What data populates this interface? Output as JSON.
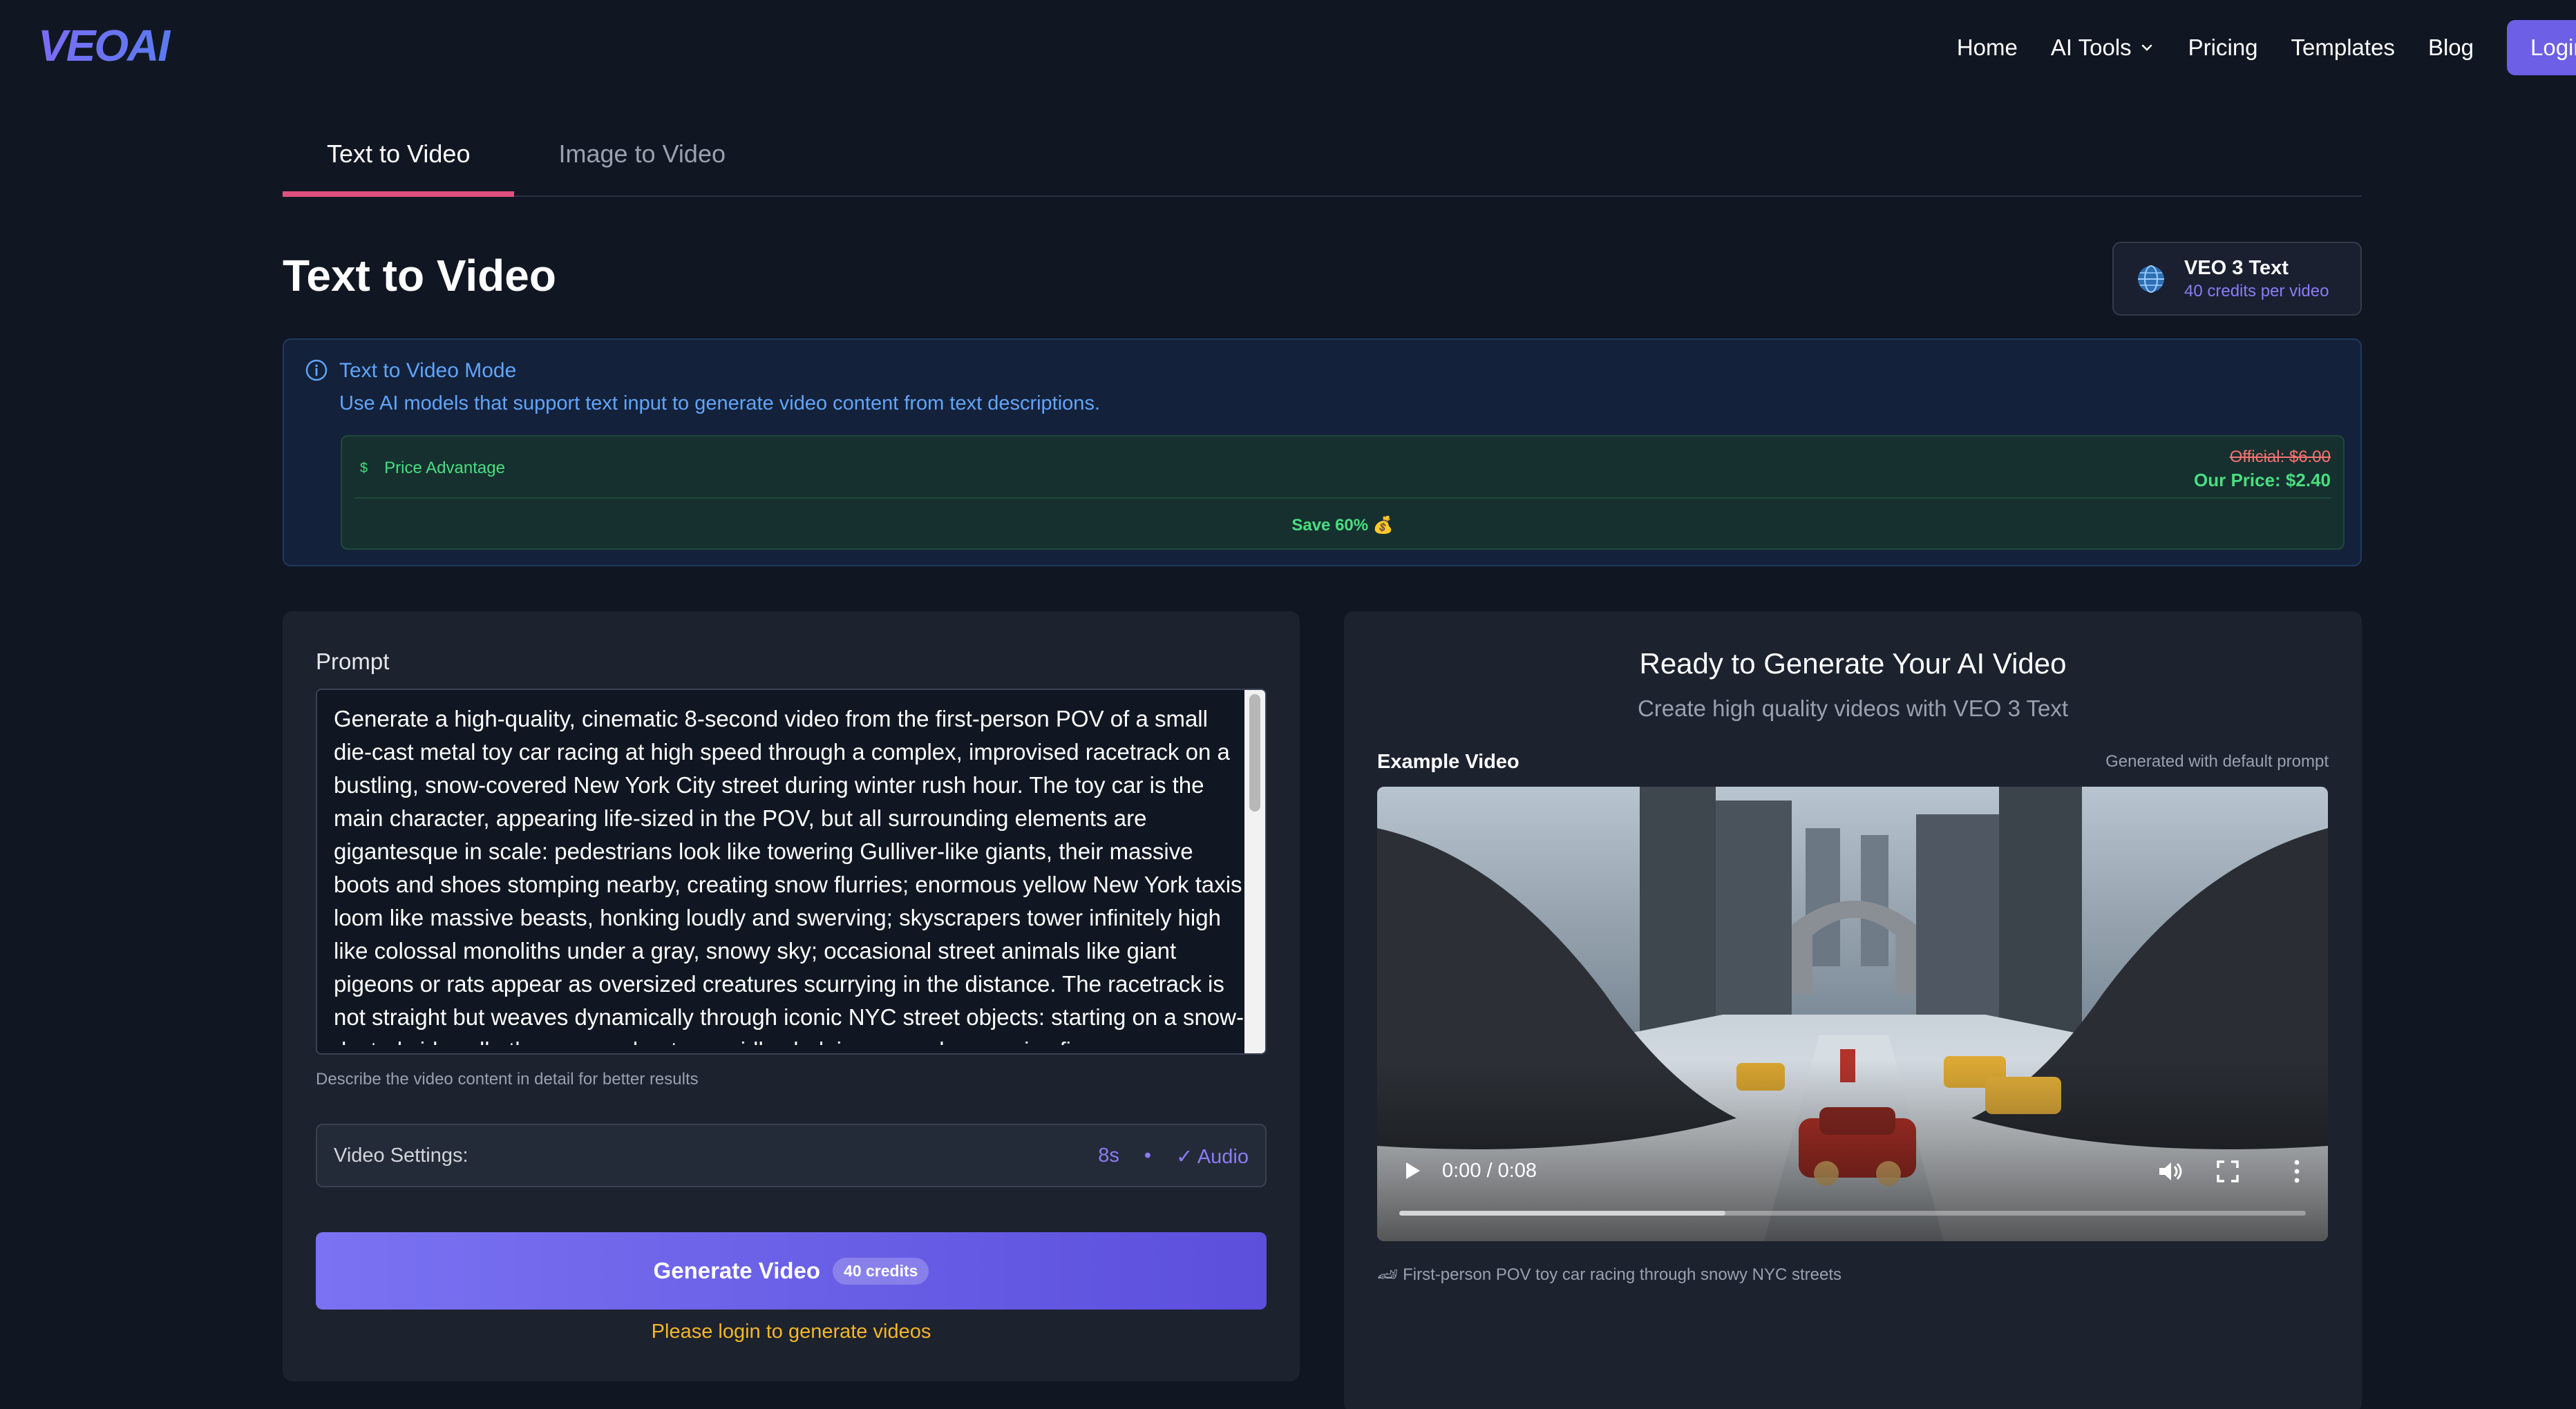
{
  "nav": {
    "logo_text": "VEOAI",
    "links": [
      {
        "label": "Home"
      },
      {
        "label": "AI Tools",
        "icon": "chevron-down-icon"
      },
      {
        "label": "Pricing"
      },
      {
        "label": "Templates"
      },
      {
        "label": "Blog"
      }
    ],
    "login_label": "Login"
  },
  "tabs": [
    {
      "label": "Text to Video",
      "active": true
    },
    {
      "label": "Image to Video",
      "active": false
    }
  ],
  "page": {
    "title": "Text to Video"
  },
  "model": {
    "icon": "globe-icon",
    "name": "VEO 3 Text",
    "credits": "40 credits per video"
  },
  "info": {
    "icon": "info-icon",
    "title": "Text to Video Mode",
    "description": "Use AI models that support text input to generate video content from text descriptions.",
    "price": {
      "icon": "dollar-icon",
      "label": "Price Advantage",
      "official": "Official: $6.00",
      "ours": "Our Price: $2.40",
      "save": "Save 60% 💰"
    }
  },
  "form": {
    "prompt_label": "Prompt",
    "prompt_value": "Generate a high-quality, cinematic 8-second video from the first-person POV of a small die-cast metal toy car racing at high speed through a complex, improvised racetrack on a bustling, snow-covered New York City street during winter rush hour. The toy car is the main character, appearing life-sized in the POV, but all surrounding elements are gigantesque in scale: pedestrians look like towering Gulliver-like giants, their massive boots and shoes stomping nearby, creating snow flurries; enormous yellow New York taxis loom like massive beasts, honking loudly and swerving; skyscrapers tower infinitely high like colossal monoliths under a gray, snowy sky; occasional street animals like giant pigeons or rats appear as oversized creatures scurrying in the distance. The racetrack is not straight but weaves dynamically through iconic NYC street objects: starting on a snow-dusted sidewalk, the car accelerates rapidly, dodging around a massive fire",
    "prompt_hint": "Describe the video content in detail for better results",
    "settings_label": "Video Settings:",
    "duration": "8s",
    "separator": "•",
    "audio": "✓ Audio",
    "generate_label": "Generate Video",
    "generate_credits": "40 credits",
    "login_note": "Please login to generate videos"
  },
  "preview": {
    "title": "Ready to Generate Your AI Video",
    "subtitle": "Create high quality videos with VEO 3 Text",
    "example_label": "Example Video",
    "example_note": "Generated with default prompt",
    "time": "0:00 / 0:08",
    "progress": 0.36,
    "caption": "🏎 First-person POV toy car racing through snowy NYC streets"
  },
  "colors": {
    "background": "#111722",
    "accent": "#6d5fe6",
    "tab_underline": "#e0507e",
    "info_blue": "#60a5fa",
    "price_green": "#4ade80",
    "warning": "#f5b62a"
  }
}
